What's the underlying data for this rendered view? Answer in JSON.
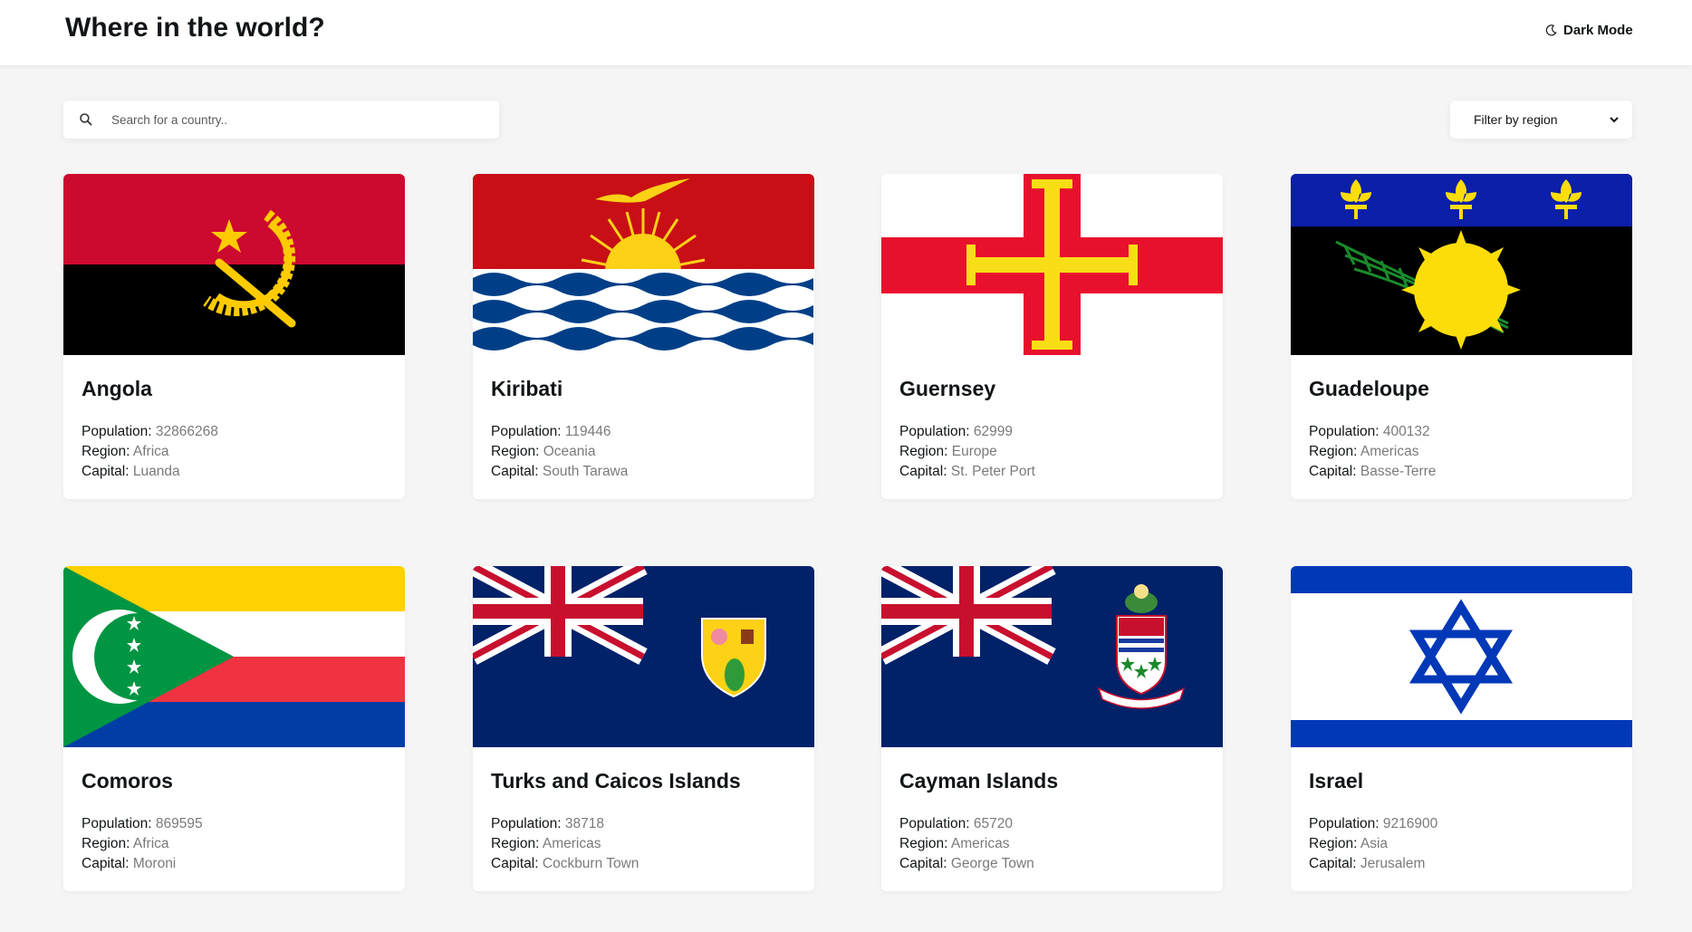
{
  "header": {
    "title": "Where in the world?",
    "dark_mode_label": "Dark Mode"
  },
  "search": {
    "placeholder": "Search for a country..",
    "value": ""
  },
  "filter": {
    "label": "Filter by region"
  },
  "labels": {
    "population": "Population:",
    "region": "Region:",
    "capital": "Capital:"
  },
  "countries": [
    {
      "name": "Angola",
      "population": "32866268",
      "region": "Africa",
      "capital": "Luanda",
      "flag": "angola-flag"
    },
    {
      "name": "Kiribati",
      "population": "119446",
      "region": "Oceania",
      "capital": "South Tarawa",
      "flag": "kiribati-flag"
    },
    {
      "name": "Guernsey",
      "population": "62999",
      "region": "Europe",
      "capital": "St. Peter Port",
      "flag": "guernsey-flag"
    },
    {
      "name": "Guadeloupe",
      "population": "400132",
      "region": "Americas",
      "capital": "Basse-Terre",
      "flag": "guadeloupe-flag"
    },
    {
      "name": "Comoros",
      "population": "869595",
      "region": "Africa",
      "capital": "Moroni",
      "flag": "comoros-flag"
    },
    {
      "name": "Turks and Caicos Islands",
      "population": "38718",
      "region": "Americas",
      "capital": "Cockburn Town",
      "flag": "turks-and-caicos-flag"
    },
    {
      "name": "Cayman Islands",
      "population": "65720",
      "region": "Americas",
      "capital": "George Town",
      "flag": "cayman-islands-flag"
    },
    {
      "name": "Israel",
      "population": "9216900",
      "region": "Asia",
      "capital": "Jerusalem",
      "flag": "israel-flag"
    }
  ],
  "icons": {
    "search": "search-icon",
    "dark_mode": "moon-icon",
    "filter_chevron": "chevron-down-icon"
  }
}
